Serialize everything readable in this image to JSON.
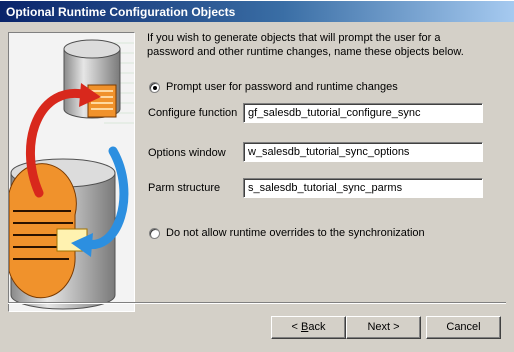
{
  "window": {
    "title": "Optional Runtime Configuration Objects"
  },
  "intro_text": "If you wish to generate objects that will prompt the user for a password and other runtime changes, name these objects below.",
  "options": {
    "prompt_label": "Prompt user for password and runtime changes",
    "prompt_selected": true,
    "no_overrides_label": "Do not allow runtime overrides to the synchronization",
    "no_overrides_selected": false
  },
  "fields": {
    "configure_function": {
      "label": "Configure function",
      "value": "gf_salesdb_tutorial_configure_sync"
    },
    "options_window": {
      "label": "Options window",
      "value": "w_salesdb_tutorial_sync_options"
    },
    "parm_structure": {
      "label": "Parm structure",
      "value": "s_salesdb_tutorial_sync_parms"
    }
  },
  "buttons": {
    "back_prefix": "< ",
    "back_key": "B",
    "back_rest": "ack",
    "next": "Next >",
    "cancel": "Cancel"
  },
  "colors": {
    "title_active": "#0a246a",
    "dialog_face": "#d4d0c8",
    "arrow_red": "#d8281c",
    "arrow_blue": "#2c8fe0",
    "stack_orange": "#f0922c"
  }
}
